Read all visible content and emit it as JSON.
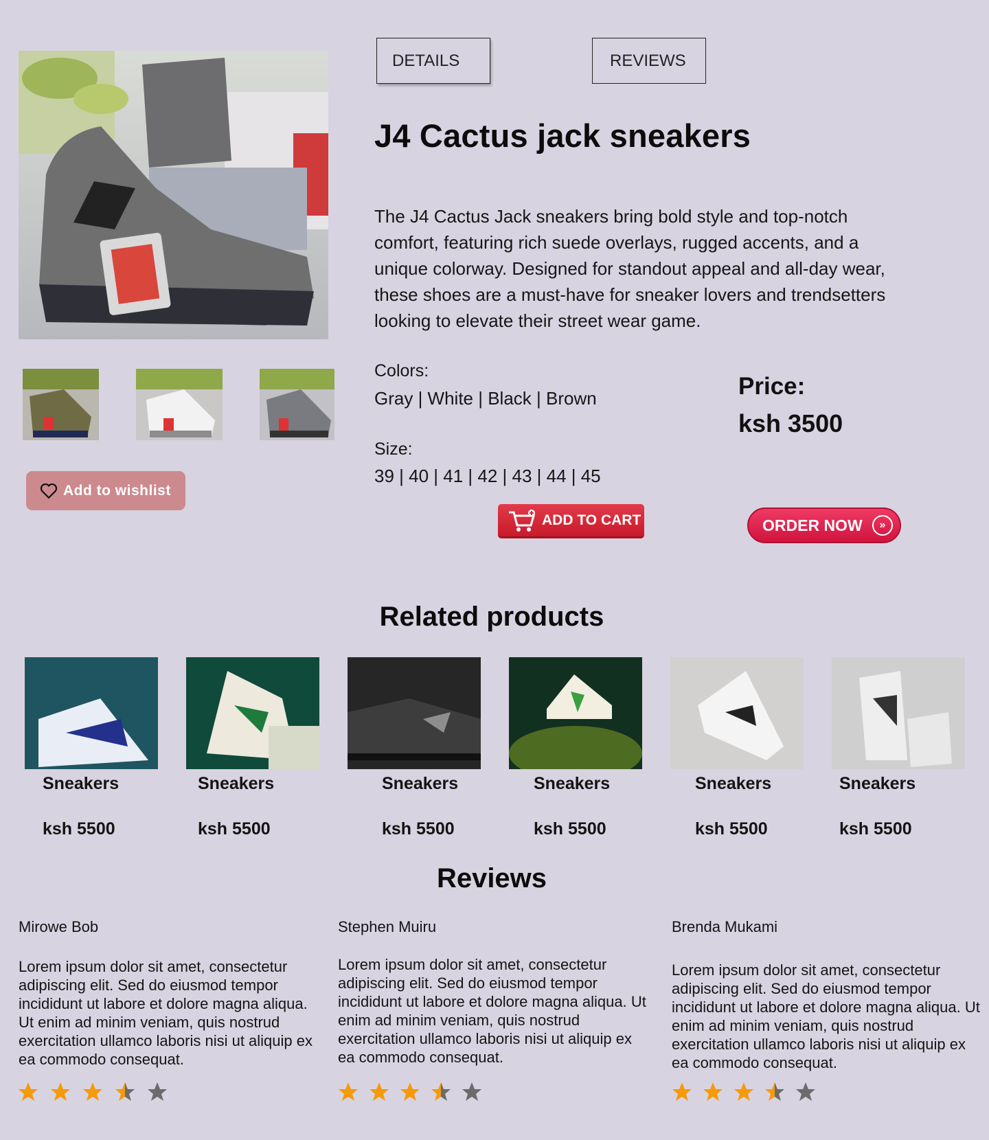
{
  "tabs": [
    {
      "label": "DETAILS",
      "active": true
    },
    {
      "label": "REVIEWS",
      "active": false
    }
  ],
  "product": {
    "title": "J4 Cactus jack sneakers",
    "description": "The J4 Cactus Jack sneakers bring bold style and top-notch comfort, featuring rich suede overlays, rugged accents, and a unique colorway. Designed for standout appeal and all-day wear, these shoes are a must-have for sneaker lovers and trendsetters looking to elevate their street wear game.",
    "colors_label": "Colors:",
    "colors": "Gray | White | Black | Brown",
    "size_label": "Size:",
    "sizes": "39 | 40 | 41 | 42 | 43 | 44 | 45",
    "price_label": "Price:",
    "price": "ksh 3500"
  },
  "buttons": {
    "wishlist": "Add to wishlist",
    "cart": "ADD TO CART",
    "order": "ORDER NOW"
  },
  "related": {
    "title": "Related products",
    "items": [
      {
        "name": "Sneakers",
        "price": "ksh 5500"
      },
      {
        "name": "Sneakers",
        "price": "ksh 5500"
      },
      {
        "name": "Sneakers",
        "price": "ksh 5500"
      },
      {
        "name": "Sneakers",
        "price": "ksh 5500"
      },
      {
        "name": "Sneakers",
        "price": "ksh 5500"
      },
      {
        "name": "Sneakers",
        "price": "ksh 5500"
      }
    ]
  },
  "reviews": {
    "title": "Reviews",
    "items": [
      {
        "name": "Mirowe Bob",
        "text": "Lorem ipsum dolor sit amet, consectetur adipiscing elit. Sed do eiusmod tempor incididunt ut labore et dolore magna aliqua. Ut enim ad minim veniam, quis nostrud exercitation ullamco laboris nisi ut aliquip ex ea commodo consequat.",
        "rating": 3.5
      },
      {
        "name": "Stephen Muiru",
        "text": "Lorem ipsum dolor sit amet, consectetur adipiscing elit. Sed do eiusmod tempor incididunt ut labore et dolore magna aliqua. Ut enim ad minim veniam, quis nostrud exercitation ullamco laboris nisi ut aliquip ex ea commodo consequat.",
        "rating": 3.5
      },
      {
        "name": "Brenda Mukami",
        "text": "Lorem ipsum dolor sit amet, consectetur adipiscing elit. Sed do eiusmod tempor incididunt ut labore et dolore magna aliqua. Ut enim ad minim veniam, quis nostrud exercitation ullamco laboris nisi ut aliquip ex ea commodo consequat.",
        "rating": 3.5
      }
    ]
  },
  "colors": {
    "background": "#d8d3e0",
    "wishlist": "#cc8a8e",
    "cart": "#d32636",
    "order": "#e2224f",
    "star_filled": "#f59a0c",
    "star_empty": "#6b6b6b"
  }
}
